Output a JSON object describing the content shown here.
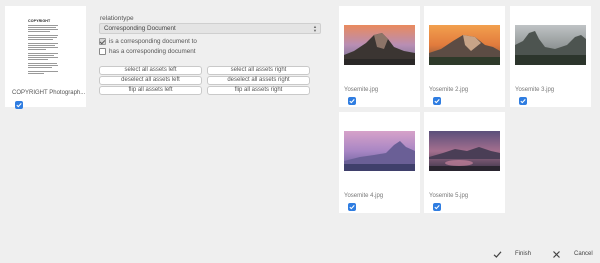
{
  "document_card": {
    "thumbnail_heading": "COPYRIGHT",
    "name": "COPYRIGHT Photograph...",
    "checked": true
  },
  "relation": {
    "label": "relationtype",
    "selected_value": "Corresponding Document",
    "options": [
      {
        "label": "is a corresponding document to",
        "checked": true
      },
      {
        "label": "has a corresponding document",
        "checked": false
      }
    ]
  },
  "actions": {
    "select_all_left": "select all assets left",
    "select_all_right": "select all assets right",
    "deselect_all_left": "deselect all assets left",
    "deselect_all_right": "deselect all assets right",
    "flip_all_left": "flip all assets left",
    "flip_all_right": "flip all assets right"
  },
  "images": [
    {
      "name": "Yosemite.jpg",
      "checked": true
    },
    {
      "name": "Yosemite 2.jpg",
      "checked": true
    },
    {
      "name": "Yosemite 3.jpg",
      "checked": true
    },
    {
      "name": "Yosemite 4.jpg",
      "checked": true
    },
    {
      "name": "Yosemite 5.jpg",
      "checked": true
    }
  ],
  "footer": {
    "finish_label": "Finish",
    "cancel_label": "Cancel"
  },
  "colors": {
    "accent": "#2f7de1",
    "background": "#efefef",
    "card": "#ffffff"
  }
}
